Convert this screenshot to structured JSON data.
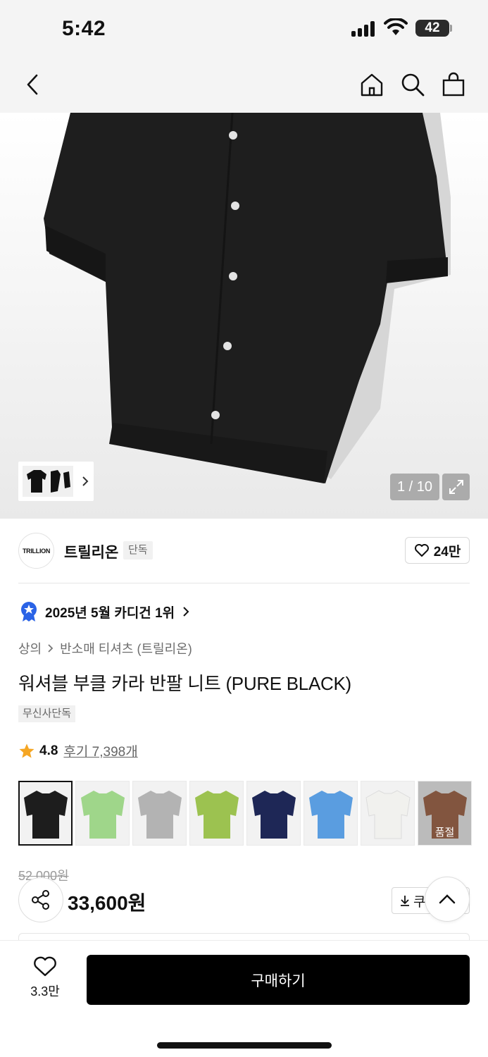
{
  "status_bar": {
    "time": "5:42",
    "battery": "42"
  },
  "gallery": {
    "counter": "1 / 10"
  },
  "brand": {
    "logo_text": "TRILLION",
    "name": "트릴리온",
    "badge": "단독",
    "like_count": "24만"
  },
  "ranking": {
    "text": "2025년 5월 카디건 1위"
  },
  "breadcrumb": {
    "level1": "상의",
    "level2": "반소매 티셔츠 (트릴리온)"
  },
  "product": {
    "title": "워셔블 부클 카라 반팔 니트 (PURE BLACK)",
    "tag": "무신사단독",
    "rating": "4.8",
    "reviews": "후기 7,398개",
    "original_price": "52,000원",
    "price": "33,600원",
    "coupon_label": "쿠"
  },
  "swatches": [
    {
      "color": "#1d1d1d",
      "selected": true
    },
    {
      "color": "#9fd68a"
    },
    {
      "color": "#b3b3b3"
    },
    {
      "color": "#9cc250"
    },
    {
      "color": "#1e2756"
    },
    {
      "color": "#5a9de0"
    },
    {
      "color": "#f1f1ee"
    },
    {
      "color": "#8a3a12",
      "sold_out": "품절"
    }
  ],
  "bottom_bar": {
    "favorite_count": "3.3만",
    "buy_label": "구매하기"
  },
  "colors": {
    "accent_star": "#f5a623",
    "rank_badge": "#2a63e6",
    "button": "#000000"
  }
}
